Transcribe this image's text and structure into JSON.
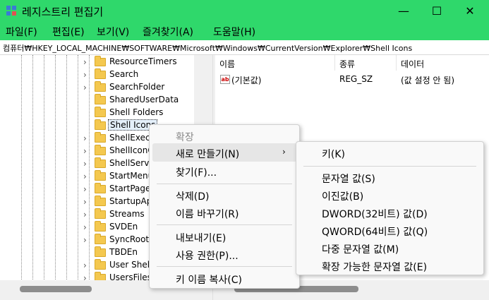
{
  "window": {
    "title": "레지스트리 편집기",
    "minimize_glyph": "—",
    "maximize_glyph": "☐",
    "close_glyph": "✕",
    "accent_color": "#2fd86b"
  },
  "menubar": {
    "items": [
      "파일(F)",
      "편집(E)",
      "보기(V)",
      "즐겨찾기(A)",
      "도움말(H)"
    ]
  },
  "address": {
    "path": "컴퓨터₩HKEY_LOCAL_MACHINE₩SOFTWARE₩Microsoft₩Windows₩CurrentVersion₩Explorer₩Shell Icons"
  },
  "tree": {
    "items": [
      {
        "label": "ResourceTimers",
        "icon": "folder-icon"
      },
      {
        "label": "Search",
        "icon": "folder-icon"
      },
      {
        "label": "SearchFolder",
        "icon": "folder-icon"
      },
      {
        "label": "SharedUserData",
        "icon": "folder-icon"
      },
      {
        "label": "Shell Folders",
        "icon": "folder-icon"
      },
      {
        "label": "Shell Icons",
        "icon": "folder-icon",
        "selected": true
      },
      {
        "label": "ShellExecu",
        "icon": "folder-icon"
      },
      {
        "label": "ShellIconO",
        "icon": "folder-icon"
      },
      {
        "label": "ShellServic",
        "icon": "folder-icon"
      },
      {
        "label": "StartMenu",
        "icon": "folder-icon"
      },
      {
        "label": "StartPage",
        "icon": "folder-icon"
      },
      {
        "label": "StartupAp",
        "icon": "folder-icon"
      },
      {
        "label": "Streams",
        "icon": "folder-icon"
      },
      {
        "label": "SVDEn",
        "icon": "folder-icon"
      },
      {
        "label": "SyncRootM",
        "icon": "folder-icon"
      },
      {
        "label": "TBDEn",
        "icon": "folder-icon"
      },
      {
        "label": "User Shell",
        "icon": "folder-icon"
      },
      {
        "label": "UsersFiles",
        "icon": "folder-icon"
      }
    ]
  },
  "list": {
    "columns": [
      "이름",
      "종류",
      "데이터"
    ],
    "rows": [
      {
        "name": "(기본값)",
        "type": "REG_SZ",
        "data": "(값 설정 안 됨)",
        "icon": "string-value-icon"
      }
    ]
  },
  "context_menu": {
    "expand": "확장",
    "new": "새로 만들기(N)",
    "find": "찾기(F)...",
    "delete": "삭제(D)",
    "rename": "이름 바꾸기(R)",
    "export": "내보내기(E)",
    "permissions": "사용 권한(P)...",
    "copy_key_name": "키 이름 복사(C)",
    "submenu_arrow": "›"
  },
  "submenu": {
    "key": "키(K)",
    "string_value": "문자열 값(S)",
    "binary_value": "이진값(B)",
    "dword_value": "DWORD(32비트) 값(D)",
    "qword_value": "QWORD(64비트) 값(Q)",
    "multi_string_value": "다중 문자열 값(M)",
    "expandable_string_value": "확장 가능한 문자열 값(E)"
  }
}
